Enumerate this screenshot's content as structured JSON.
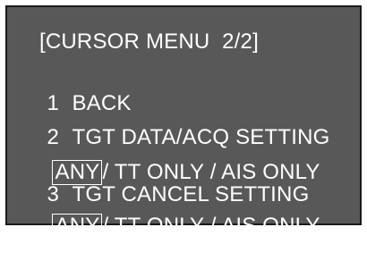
{
  "menu": {
    "title": "[CURSOR MENU  2/2]",
    "items": [
      {
        "number": "1",
        "label": "BACK"
      },
      {
        "number": "2",
        "label": "TGT DATA/ACQ SETTING",
        "options": {
          "selected": "ANY",
          "rest": "/ TT ONLY / AIS ONLY"
        }
      },
      {
        "number": "3",
        "label": "TGT CANCEL SETTING",
        "options": {
          "selected": "ANY",
          "rest": "/ TT ONLY / AIS ONLY"
        }
      }
    ]
  },
  "colors": {
    "panel_background": "#585858",
    "text": "#ffffff",
    "border": "#1a1a1a"
  }
}
